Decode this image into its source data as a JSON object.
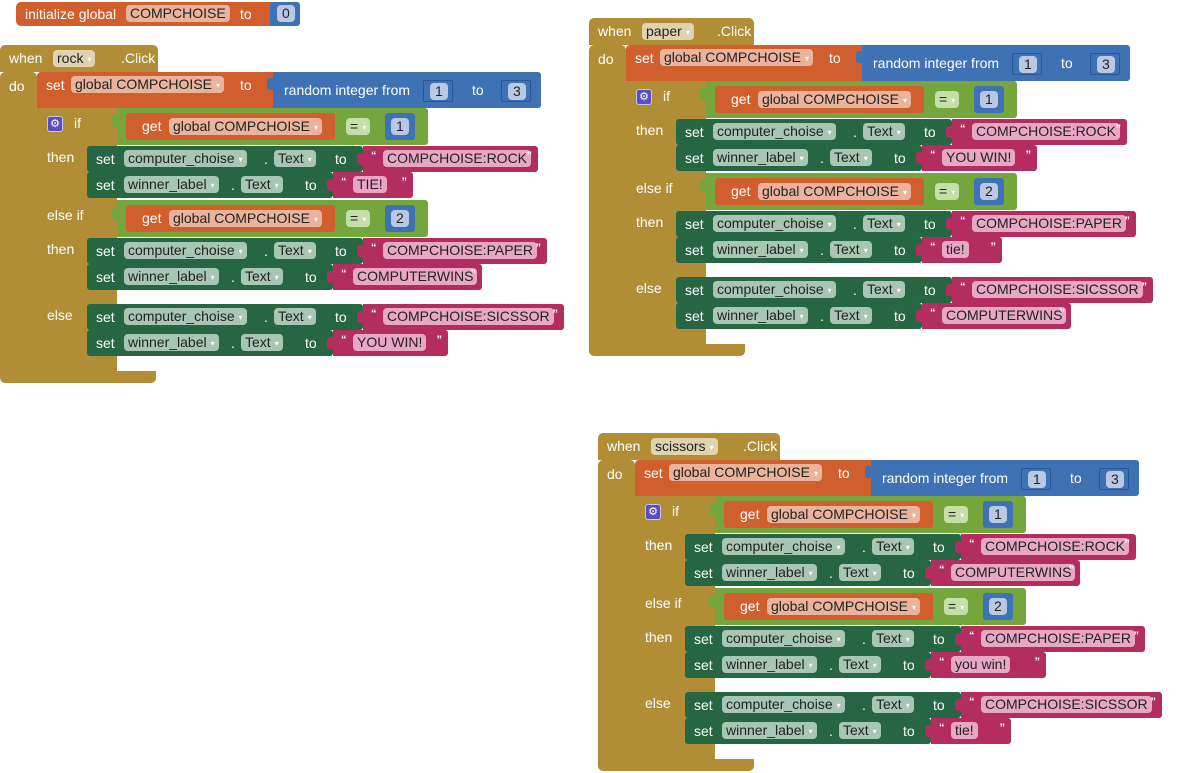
{
  "init_block": {
    "keyword": "initialize global",
    "var_name": "COMPCHOISE",
    "to_label": "to",
    "value": "0"
  },
  "event_blocks": [
    {
      "component": "rock",
      "when_label": "when",
      "event_label": ".Click",
      "do_label": "do",
      "set_label": "set",
      "set_var": "global COMPCHOISE",
      "to_label": "to",
      "random_label": "random integer from",
      "random_from": "1",
      "random_to_label": "to",
      "random_to": "3",
      "if_label": "if",
      "elseif_label": "else if",
      "then_label": "then",
      "else_label": "else",
      "get_label": "get",
      "get_var": "global COMPCHOISE",
      "eq_op": "=",
      "branches": [
        {
          "compare_value": "1",
          "computer_choise": "COMPCHOISE:ROCK",
          "winner_label": "TIE!"
        },
        {
          "compare_value": "2",
          "computer_choise": "COMPCHOISE:PAPER",
          "winner_label": "COMPUTERWINS"
        },
        {
          "computer_choise": "COMPCHOISE:SICSSOR",
          "winner_label": "YOU WIN!"
        }
      ]
    },
    {
      "component": "paper",
      "when_label": "when",
      "event_label": ".Click",
      "do_label": "do",
      "set_label": "set",
      "set_var": "global COMPCHOISE",
      "to_label": "to",
      "random_label": "random integer from",
      "random_from": "1",
      "random_to_label": "to",
      "random_to": "3",
      "if_label": "if",
      "elseif_label": "else if",
      "then_label": "then",
      "else_label": "else",
      "get_label": "get",
      "get_var": "global COMPCHOISE",
      "eq_op": "=",
      "branches": [
        {
          "compare_value": "1",
          "computer_choise": "COMPCHOISE:ROCK",
          "winner_label": "YOU WIN!"
        },
        {
          "compare_value": "2",
          "computer_choise": "COMPCHOISE:PAPER",
          "winner_label": "tie!"
        },
        {
          "computer_choise": "COMPCHOISE:SICSSOR",
          "winner_label": "COMPUTERWINS"
        }
      ]
    },
    {
      "component": "scissors",
      "when_label": "when",
      "event_label": ".Click",
      "do_label": "do",
      "set_label": "set",
      "set_var": "global COMPCHOISE",
      "to_label": "to",
      "random_label": "random integer from",
      "random_from": "1",
      "random_to_label": "to",
      "random_to": "3",
      "if_label": "if",
      "elseif_label": "else if",
      "then_label": "then",
      "else_label": "else",
      "get_label": "get",
      "get_var": "global COMPCHOISE",
      "eq_op": "=",
      "branches": [
        {
          "compare_value": "1",
          "computer_choise": "COMPCHOISE:ROCK",
          "winner_label": "COMPUTERWINS"
        },
        {
          "compare_value": "2",
          "computer_choise": "COMPCHOISE:PAPER",
          "winner_label": "you win!"
        },
        {
          "computer_choise": "COMPCHOISE:SICSSOR",
          "winner_label": "tie!"
        }
      ]
    }
  ],
  "statement_labels": {
    "set": "set",
    "component_1": "computer_choise",
    "component_2": "winner_label",
    "property": "Text",
    "dot": ".",
    "to": "to",
    "open_quote": "“",
    "close_quote": "”"
  },
  "icons": {
    "dropdown": "▾",
    "mutator": "⚙"
  },
  "colors": {
    "event_control": "#b18e35",
    "variable": "#d05f2d",
    "math": "#3f71b5",
    "logic_compare": "#74a63d",
    "component_setter": "#266643",
    "text": "#b32d5e"
  }
}
